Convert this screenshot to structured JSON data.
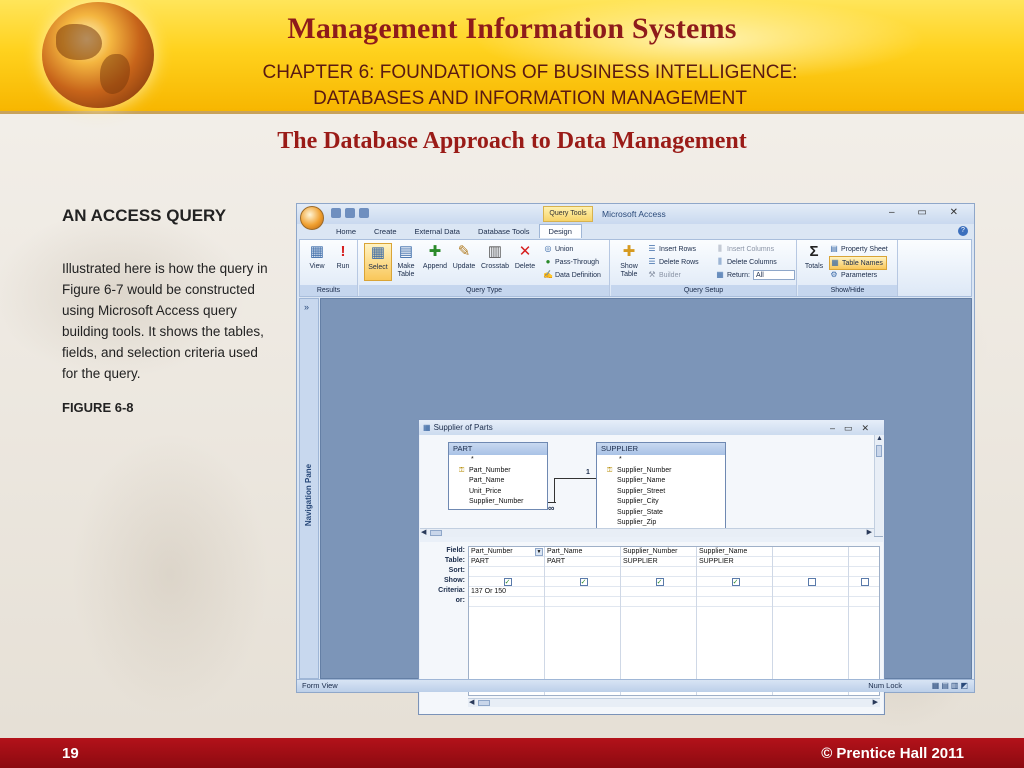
{
  "slide": {
    "title": "Management Information Systems",
    "subtitle_line1": "CHAPTER 6: FOUNDATIONS OF BUSINESS INTELLIGENCE:",
    "subtitle_line2": "DATABASES AND INFORMATION MANAGEMENT",
    "section_title": "The Database Approach to Data Management",
    "heading": "AN ACCESS QUERY",
    "body": "Illustrated here is how the query in Figure 6-7 would be constructed using Microsoft Access query building tools. It shows the tables, fields, and selection criteria used for the query.",
    "figure_label": "FIGURE 6-8",
    "page_number": "19",
    "copyright": "©  Prentice Hall 2011"
  },
  "access": {
    "app_title": "Microsoft Access",
    "context_tab_label": "Query Tools",
    "window_controls": "–  ▭  ✕",
    "tabs": [
      "Home",
      "Create",
      "External Data",
      "Database Tools",
      "Design"
    ],
    "active_tab": "Design",
    "ribbon": {
      "groups": [
        "Results",
        "Query Type",
        "Query Setup",
        "Show/Hide"
      ],
      "buttons": {
        "view": "View",
        "run": "Run",
        "select": "Select",
        "make_table": "Make Table",
        "append": "Append",
        "update": "Update",
        "crosstab": "Crosstab",
        "delete": "Delete",
        "union": "Union",
        "pass_through": "Pass-Through",
        "data_definition": "Data Definition",
        "show_table": "Show Table",
        "insert_rows": "Insert Rows",
        "delete_rows": "Delete Rows",
        "builder": "Builder",
        "insert_columns": "Insert Columns",
        "delete_columns": "Delete Columns",
        "return_label": "Return:",
        "return_value": "All",
        "totals": "Totals",
        "property_sheet": "Property Sheet",
        "table_names": "Table Names",
        "parameters": "Parameters"
      }
    },
    "nav_pane_label": "Navigation Pane",
    "status_left": "Form View",
    "status_right": "Num Lock",
    "query_window": {
      "title": "Supplier of Parts",
      "tables": [
        {
          "name": "PART",
          "fields": [
            "*",
            "Part_Number",
            "Part_Name",
            "Unit_Price",
            "Supplier_Number"
          ],
          "key": "Part_Number"
        },
        {
          "name": "SUPPLIER",
          "fields": [
            "*",
            "Supplier_Number",
            "Supplier_Name",
            "Supplier_Street",
            "Supplier_City",
            "Supplier_State",
            "Supplier_Zip"
          ],
          "key": "Supplier_Number"
        }
      ],
      "relationship": {
        "one_side": "1",
        "many_side": "∞"
      },
      "row_labels": [
        "Field:",
        "Table:",
        "Sort:",
        "Show:",
        "Criteria:",
        "or:"
      ],
      "columns": [
        {
          "field": "Part_Number",
          "table": "PART",
          "sort": "",
          "show": true,
          "criteria": "137 Or 150"
        },
        {
          "field": "Part_Name",
          "table": "PART",
          "sort": "",
          "show": true,
          "criteria": ""
        },
        {
          "field": "Supplier_Number",
          "table": "SUPPLIER",
          "sort": "",
          "show": true,
          "criteria": ""
        },
        {
          "field": "Supplier_Name",
          "table": "SUPPLIER",
          "sort": "",
          "show": true,
          "criteria": ""
        },
        {
          "field": "",
          "table": "",
          "sort": "",
          "show": false,
          "criteria": ""
        },
        {
          "field": "",
          "table": "",
          "sort": "",
          "show": false,
          "criteria": ""
        }
      ]
    }
  }
}
